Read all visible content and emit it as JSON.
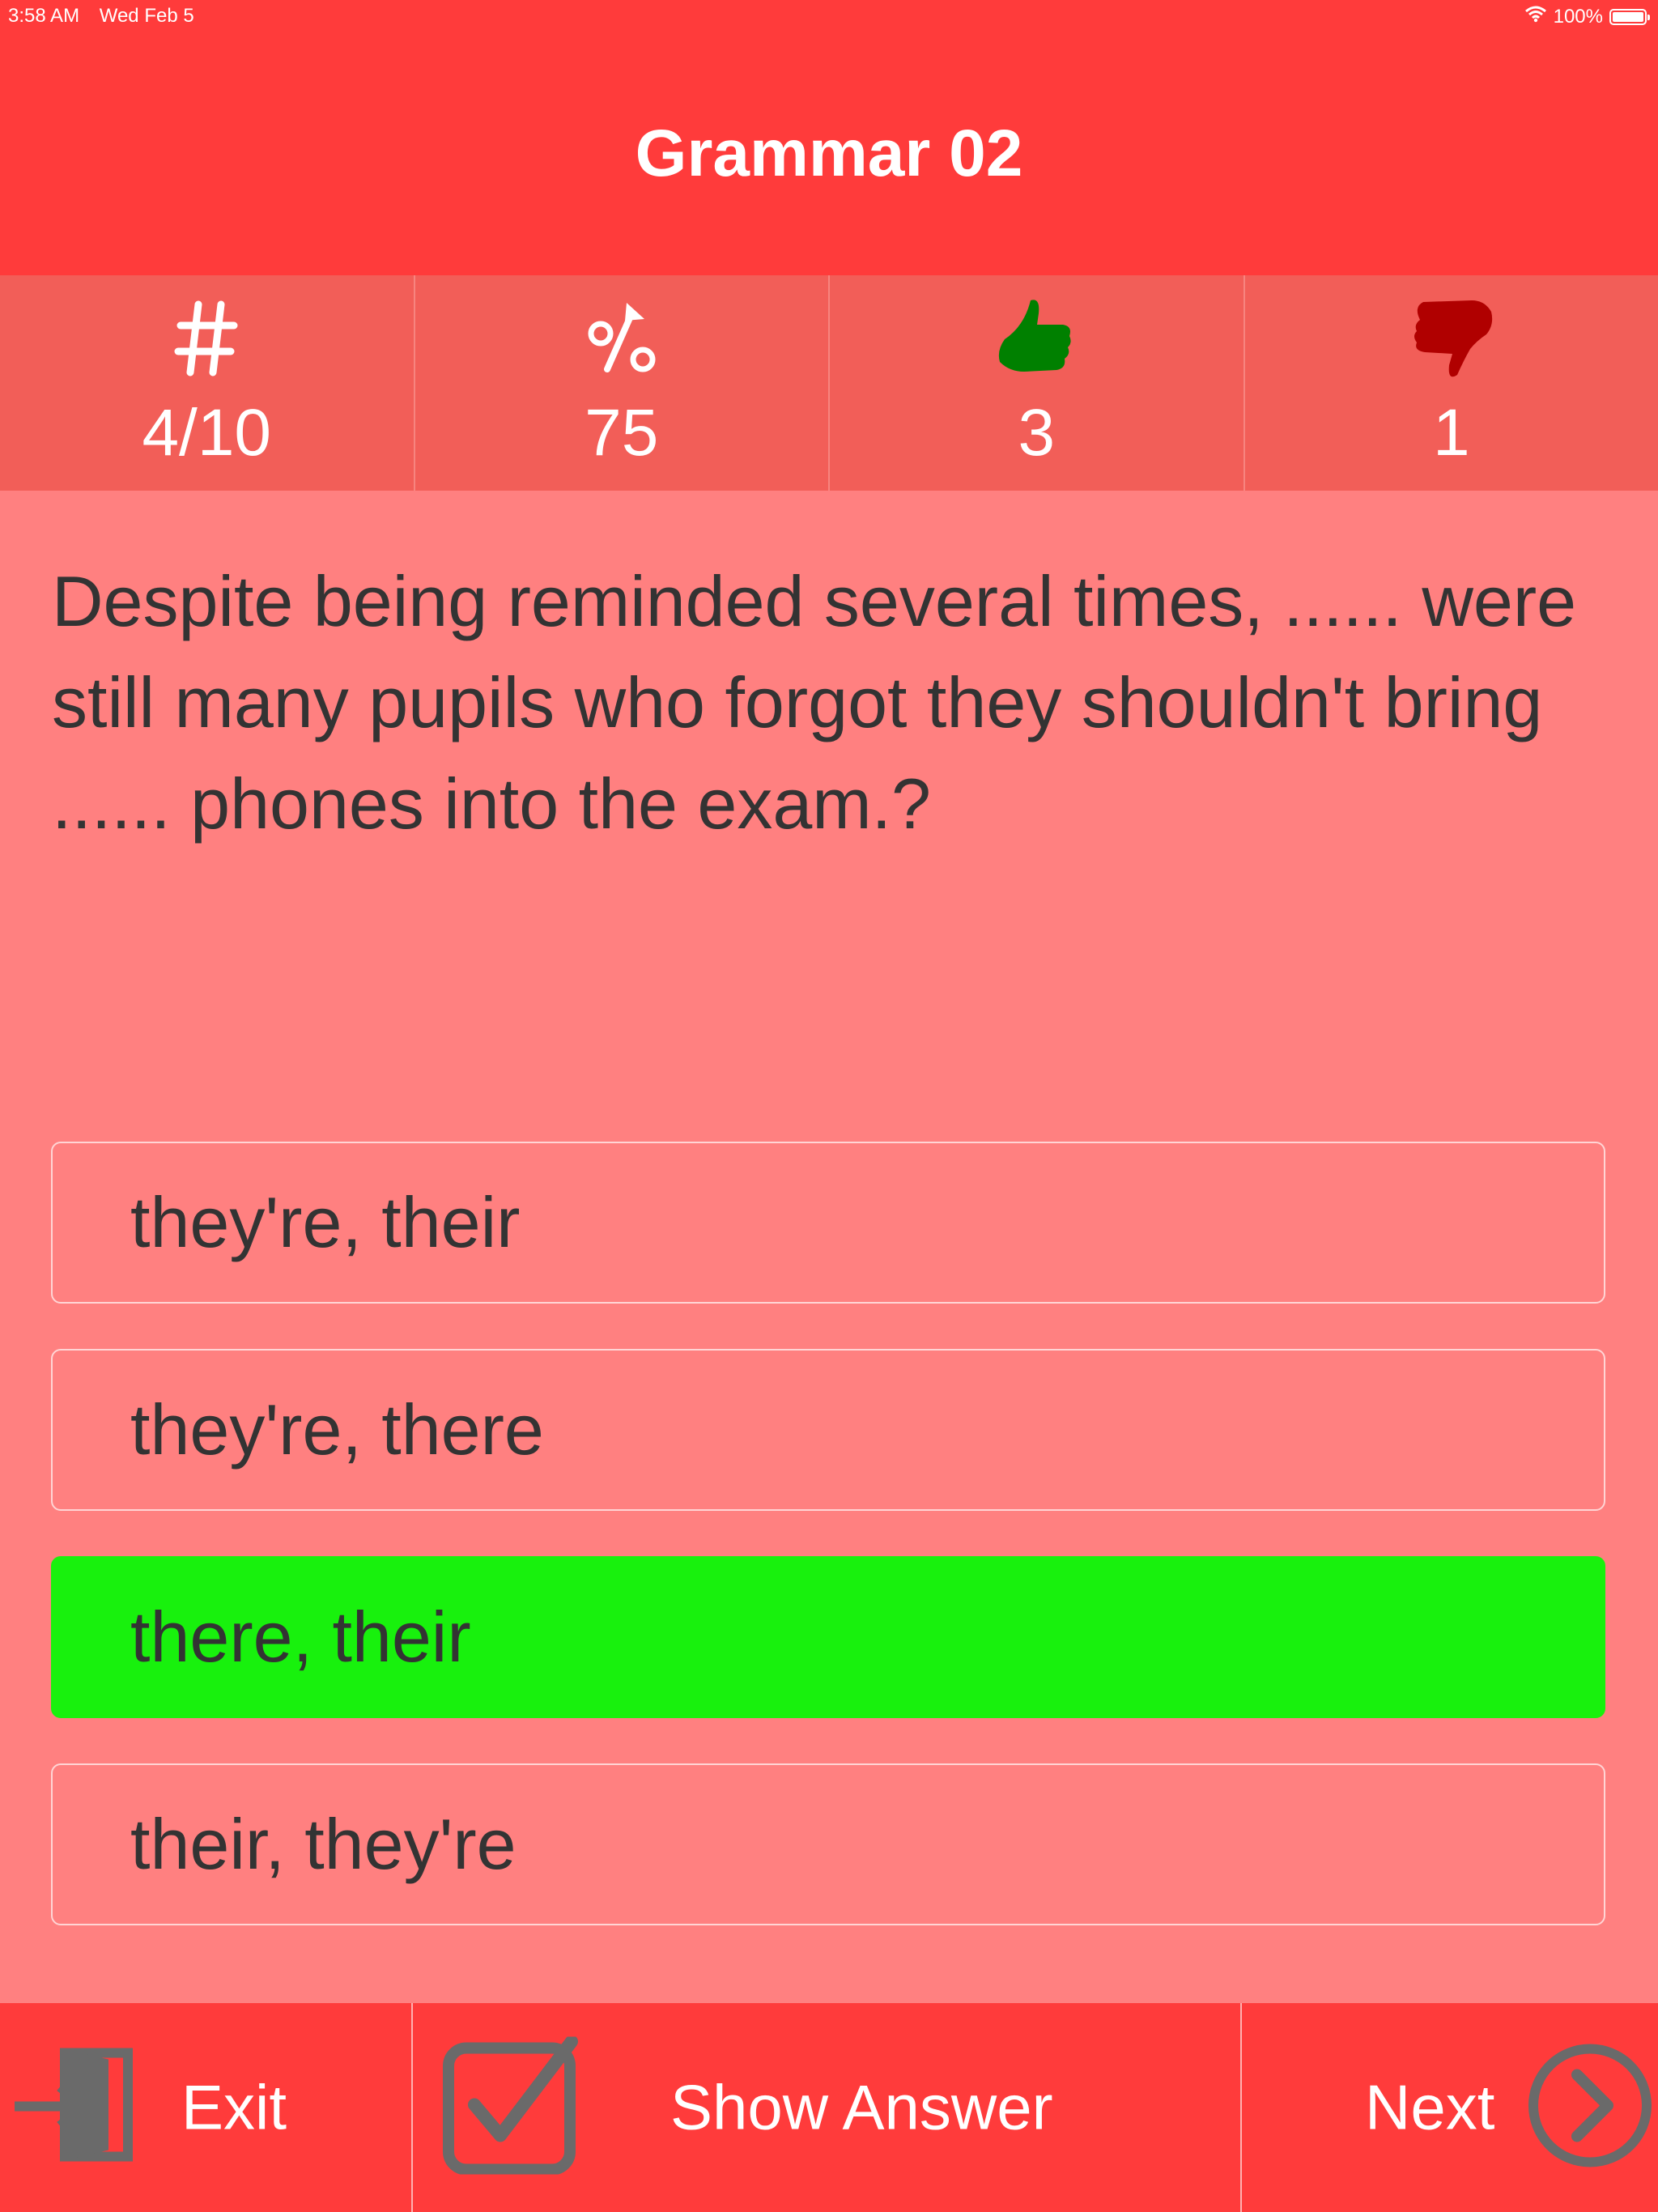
{
  "status_bar": {
    "time": "3:58 AM",
    "date": "Wed Feb 5",
    "battery": "100%"
  },
  "header": {
    "title": "Grammar 02"
  },
  "stats": [
    {
      "icon": "hash-icon",
      "value": "4/10"
    },
    {
      "icon": "percent-trend-icon",
      "value": "75"
    },
    {
      "icon": "thumbs-up-icon",
      "value": "3",
      "color": "#008000"
    },
    {
      "icon": "thumbs-down-icon",
      "value": "1",
      "color": "#b00000"
    }
  ],
  "question": {
    "text": "Despite being reminded several times, ...... were still many pupils who forgot they shouldn't bring ...... phones into the exam.?"
  },
  "options": [
    {
      "label": "they're, their",
      "state": "default"
    },
    {
      "label": "they're, there",
      "state": "default"
    },
    {
      "label": "there, their",
      "state": "correct"
    },
    {
      "label": "their, they're",
      "state": "default"
    }
  ],
  "toolbar": {
    "exit_label": "Exit",
    "show_answer_label": "Show Answer",
    "next_label": "Next"
  },
  "colors": {
    "header_bg": "#ff3b3b",
    "stats_bg": "#f25e58",
    "content_bg": "#ff8080",
    "correct_bg": "#18f10d",
    "icon_gray": "#6a6a6a"
  }
}
